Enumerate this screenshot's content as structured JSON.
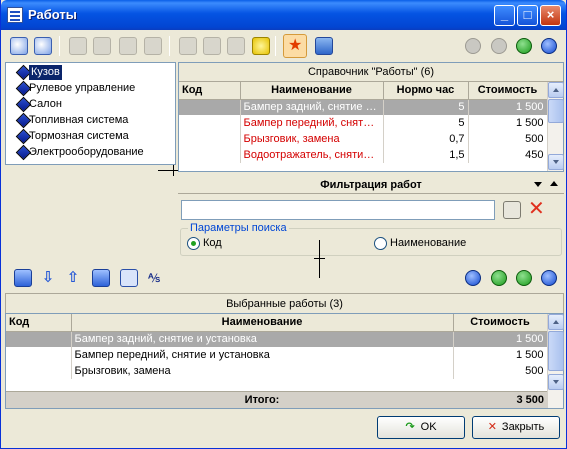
{
  "window": {
    "title": "Работы"
  },
  "tree": {
    "items": [
      {
        "label": "Кузов",
        "selected": true
      },
      {
        "label": "Рулевое управление",
        "selected": false
      },
      {
        "label": "Салон",
        "selected": false
      },
      {
        "label": "Топливная система",
        "selected": false
      },
      {
        "label": "Тормозная система",
        "selected": false
      },
      {
        "label": "Электрооборудование",
        "selected": false
      }
    ]
  },
  "catalog": {
    "caption": "Справочник \"Работы\" (6)",
    "columns": [
      "Код",
      "Наименование",
      "Нормо час",
      "Стоимость"
    ],
    "rows": [
      {
        "code": "",
        "name": "Бампер задний, снятие и ...",
        "hours": "5",
        "cost": "1 500",
        "selected": true
      },
      {
        "code": "",
        "name": "Бампер передний, снятие...",
        "hours": "5",
        "cost": "1 500",
        "selected": false
      },
      {
        "code": "",
        "name": "Брызговик, замена",
        "hours": "0,7",
        "cost": "500",
        "selected": false
      },
      {
        "code": "",
        "name": "Водоотражатель, снятие ...",
        "hours": "1,5",
        "cost": "450",
        "selected": false
      }
    ]
  },
  "filter": {
    "title": "Фильтрация работ",
    "input_value": "",
    "params_label": "Параметры поиска",
    "option_code": "Код",
    "option_name": "Наименование",
    "selected_option": "Код"
  },
  "selected": {
    "caption": "Выбранные работы (3)",
    "columns": [
      "Код",
      "Наименование",
      "Стоимость"
    ],
    "rows": [
      {
        "code": "",
        "name": "Бампер задний, снятие и установка",
        "cost": "1 500",
        "selected": true
      },
      {
        "code": "",
        "name": "Бампер передний, снятие и установка",
        "cost": "1 500",
        "selected": false
      },
      {
        "code": "",
        "name": "Брызговик, замена",
        "cost": "500",
        "selected": false
      }
    ],
    "total_label": "Итого:",
    "total_value": "3 500"
  },
  "buttons": {
    "ok": "OK",
    "close": "Закрыть"
  },
  "colors": {
    "title_bar": "#0554e3",
    "row_red": "#d40000",
    "selected_row": "#a9a9a9",
    "nav_green": "#1a9a1a",
    "nav_blue": "#1048d0"
  }
}
